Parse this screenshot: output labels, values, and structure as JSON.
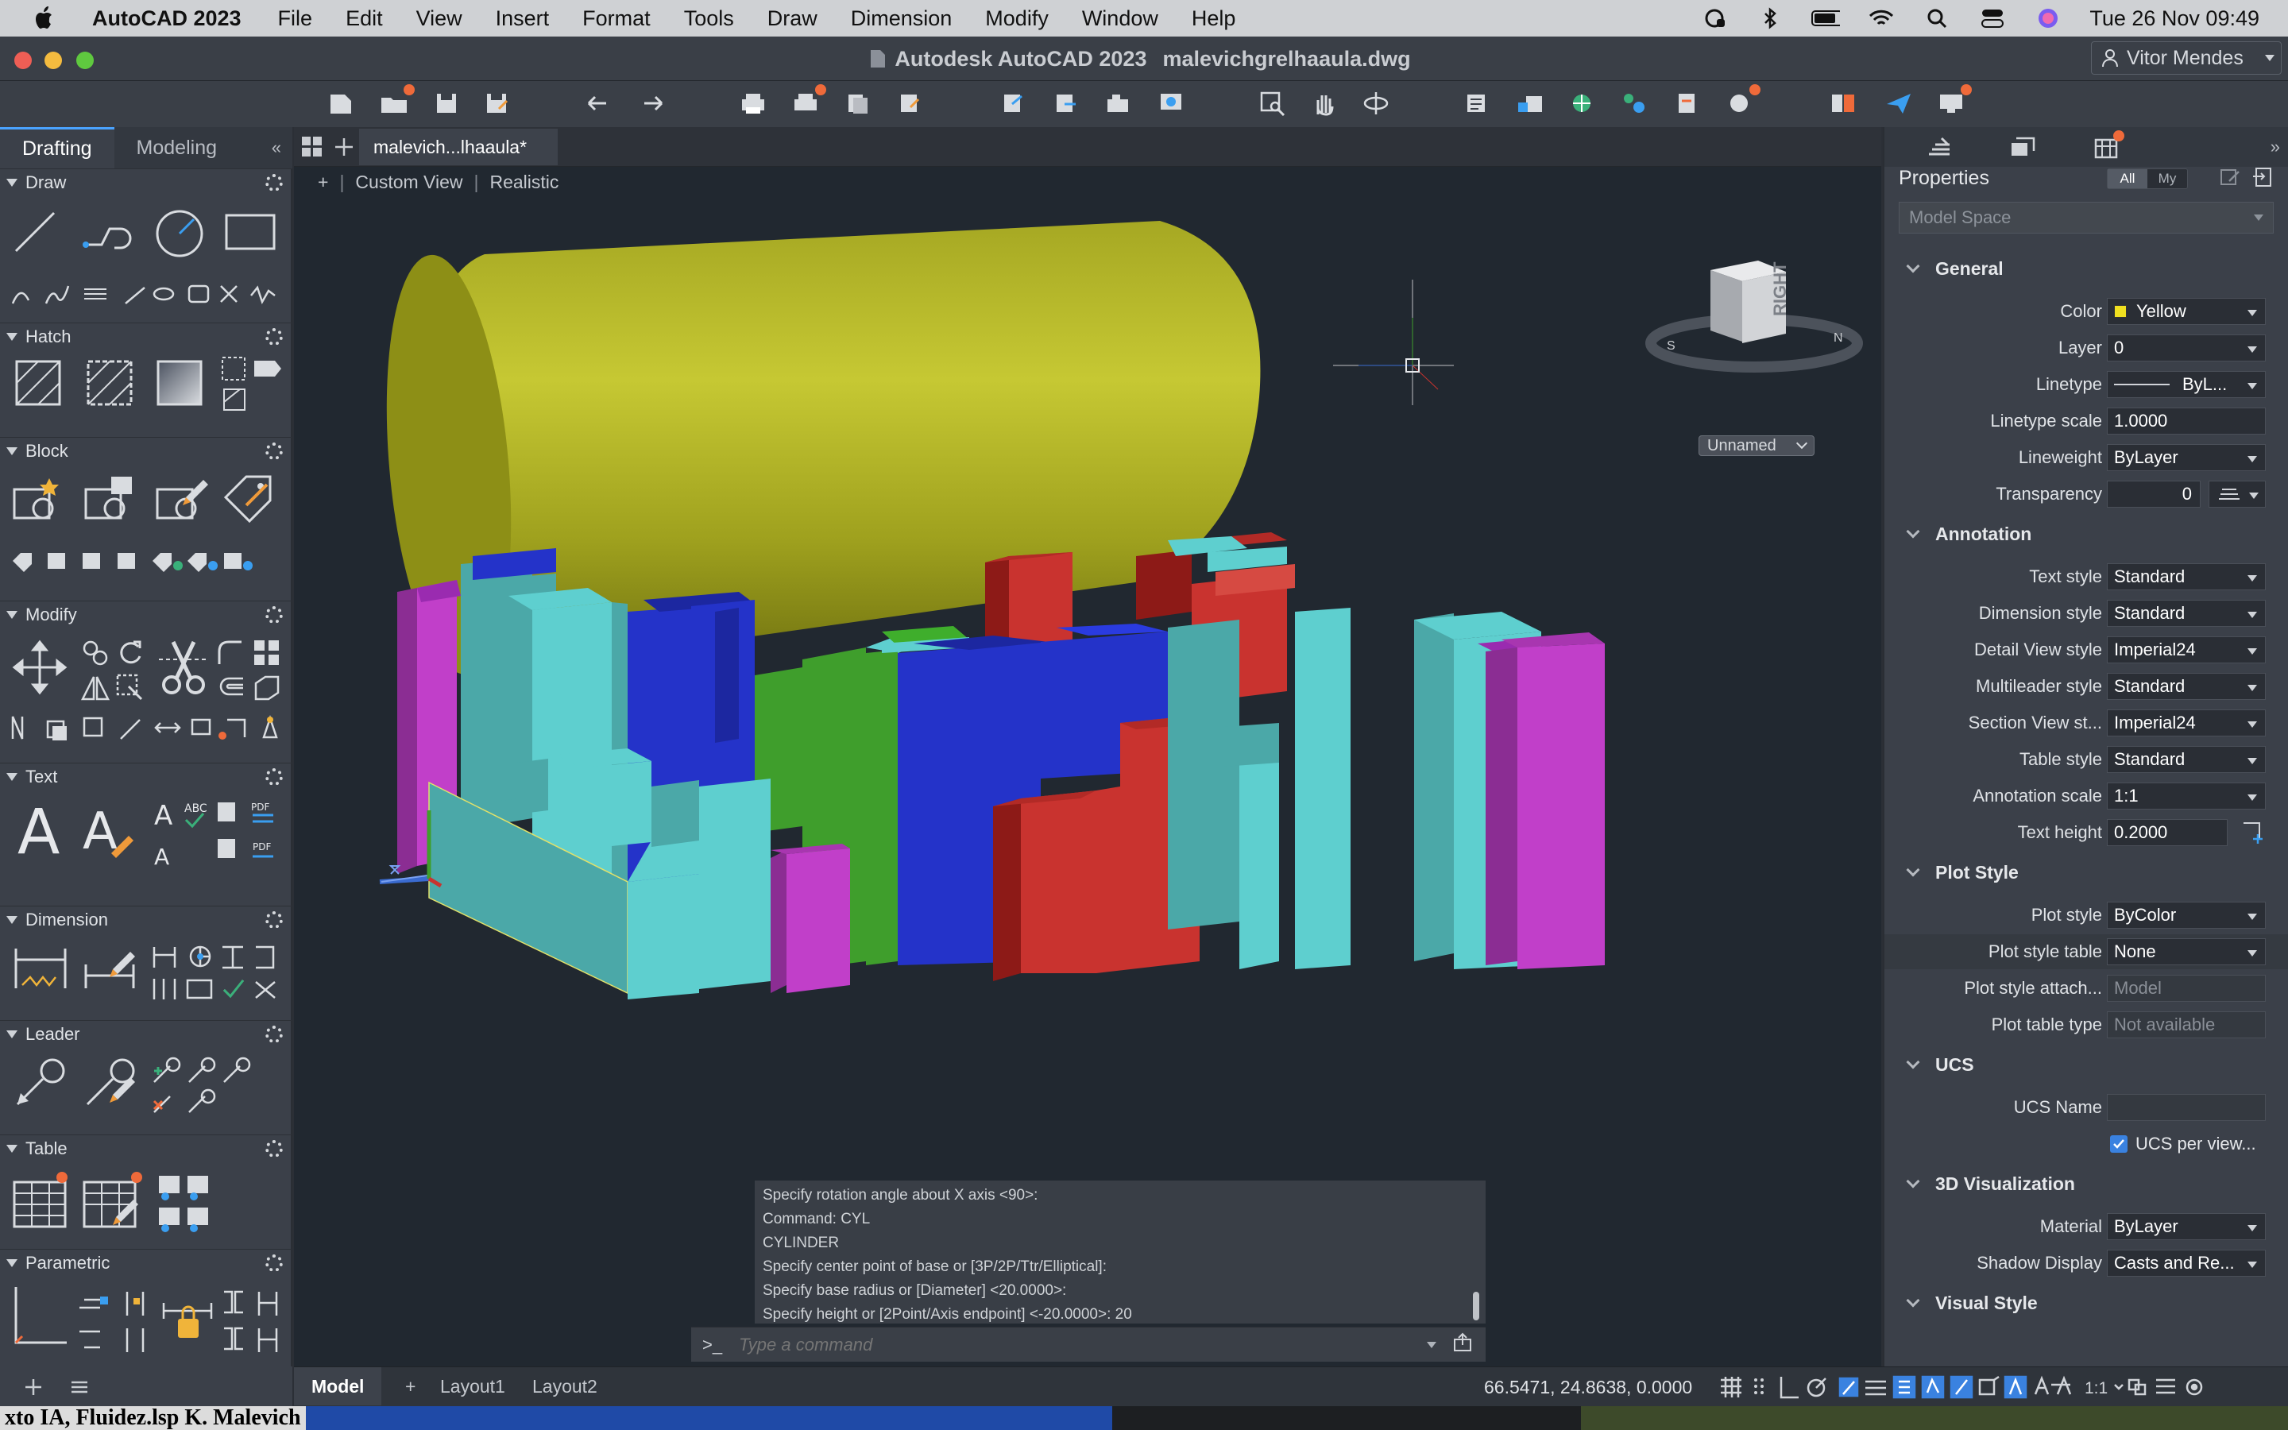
{
  "menubar": {
    "app_name": "AutoCAD 2023",
    "items": [
      "File",
      "Edit",
      "View",
      "Insert",
      "Format",
      "Tools",
      "Draw",
      "Dimension",
      "Modify",
      "Window",
      "Help"
    ],
    "datetime": "Tue 26 Nov  09:49"
  },
  "window": {
    "title_app": "Autodesk AutoCAD 2023",
    "title_file": "malevichgrelhaaula.dwg",
    "user": "Vitor Mendes"
  },
  "left_palette": {
    "tabs": [
      "Drafting",
      "Modeling"
    ],
    "sections": [
      "Draw",
      "Hatch",
      "Block",
      "Modify",
      "Text",
      "Dimension",
      "Leader",
      "Table",
      "Parametric"
    ]
  },
  "document": {
    "tab": "malevich...lhaaula*",
    "view_controls": [
      "+",
      "Custom View",
      "Realistic"
    ],
    "viewcube_face": "RIGHT",
    "viewcube_label": "Unnamed"
  },
  "command": {
    "history": [
      "Specify rotation angle about X axis <90>:",
      "Command: CYL",
      "CYLINDER",
      "Specify center point of base or [3P/2P/Ttr/Elliptical]:",
      "Specify base radius or [Diameter] <20.0000>:",
      "Specify height or [2Point/Axis endpoint] <-20.0000>: 20"
    ],
    "prompt": ">_",
    "placeholder": "Type a command"
  },
  "properties": {
    "title": "Properties",
    "filter_all": "All",
    "filter_my": "My",
    "space": "Model Space",
    "groups": {
      "general": "General",
      "annotation": "Annotation",
      "plot_style": "Plot Style",
      "ucs": "UCS",
      "viz3d": "3D Visualization",
      "visual_style": "Visual Style"
    },
    "general": [
      {
        "label": "Color",
        "value": "Yellow"
      },
      {
        "label": "Layer",
        "value": "0"
      },
      {
        "label": "Linetype",
        "value": "ByL..."
      },
      {
        "label": "Linetype scale",
        "value": "1.0000"
      },
      {
        "label": "Lineweight",
        "value": "ByLayer"
      },
      {
        "label": "Transparency",
        "value": "0"
      }
    ],
    "annotation": [
      {
        "label": "Text style",
        "value": "Standard"
      },
      {
        "label": "Dimension style",
        "value": "Standard"
      },
      {
        "label": "Detail View style",
        "value": "Imperial24"
      },
      {
        "label": "Multileader style",
        "value": "Standard"
      },
      {
        "label": "Section View st...",
        "value": "Imperial24"
      },
      {
        "label": "Table style",
        "value": "Standard"
      },
      {
        "label": "Annotation scale",
        "value": "1:1"
      },
      {
        "label": "Text height",
        "value": "0.2000"
      }
    ],
    "plot_style": [
      {
        "label": "Plot style",
        "value": "ByColor"
      },
      {
        "label": "Plot style table",
        "value": "None"
      },
      {
        "label": "Plot style attach...",
        "value": "Model"
      },
      {
        "label": "Plot table type",
        "value": "Not available"
      }
    ],
    "ucs": [
      {
        "label": "UCS Name",
        "value": ""
      },
      {
        "label": "UCS per view...",
        "value": "checked"
      }
    ],
    "viz3d": [
      {
        "label": "Material",
        "value": "ByLayer"
      },
      {
        "label": "Shadow Display",
        "value": "Casts and Re..."
      }
    ]
  },
  "statusbar": {
    "tabs": [
      "Model",
      "+",
      "Layout1",
      "Layout2"
    ],
    "coords": "66.5471,  24.8638, 0.0000",
    "scale": "1:1"
  },
  "desktop": {
    "strip_text": "xto IA, Fluidez.lsp K. Malevich"
  },
  "colors": {
    "cylinder": "#b8b82a",
    "cyan": "#5ecfcf",
    "blue": "#2433c9",
    "red": "#c9332f",
    "magenta": "#c13fc9",
    "green": "#3f9e2c"
  }
}
